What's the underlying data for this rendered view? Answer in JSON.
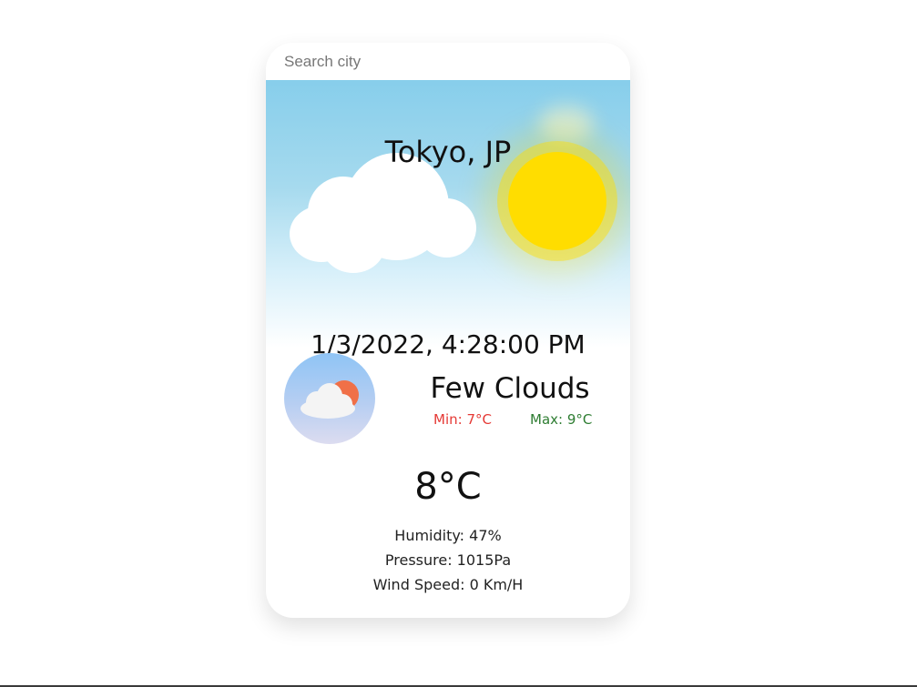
{
  "search": {
    "placeholder": "Search city",
    "value": ""
  },
  "location": {
    "city": "Tokyo, JP"
  },
  "datetime": "1/3/2022, 4:28:00 PM",
  "weather": {
    "description": "Few Clouds",
    "icon": "few-clouds-icon",
    "min": "Min: 7°C",
    "max": "Max: 9°C",
    "temperature": "8°C"
  },
  "details": {
    "humidity": "Humidity: 47%",
    "pressure": "Pressure: 1015Pa",
    "wind": "Wind Speed: 0 Km/H"
  },
  "colors": {
    "min_temp": "#e53935",
    "max_temp": "#2e7d32",
    "sun": "#ffdd00",
    "sky": "#87ceeb"
  },
  "icons": [
    "sun-icon",
    "cloud-icon",
    "few-clouds-icon"
  ]
}
